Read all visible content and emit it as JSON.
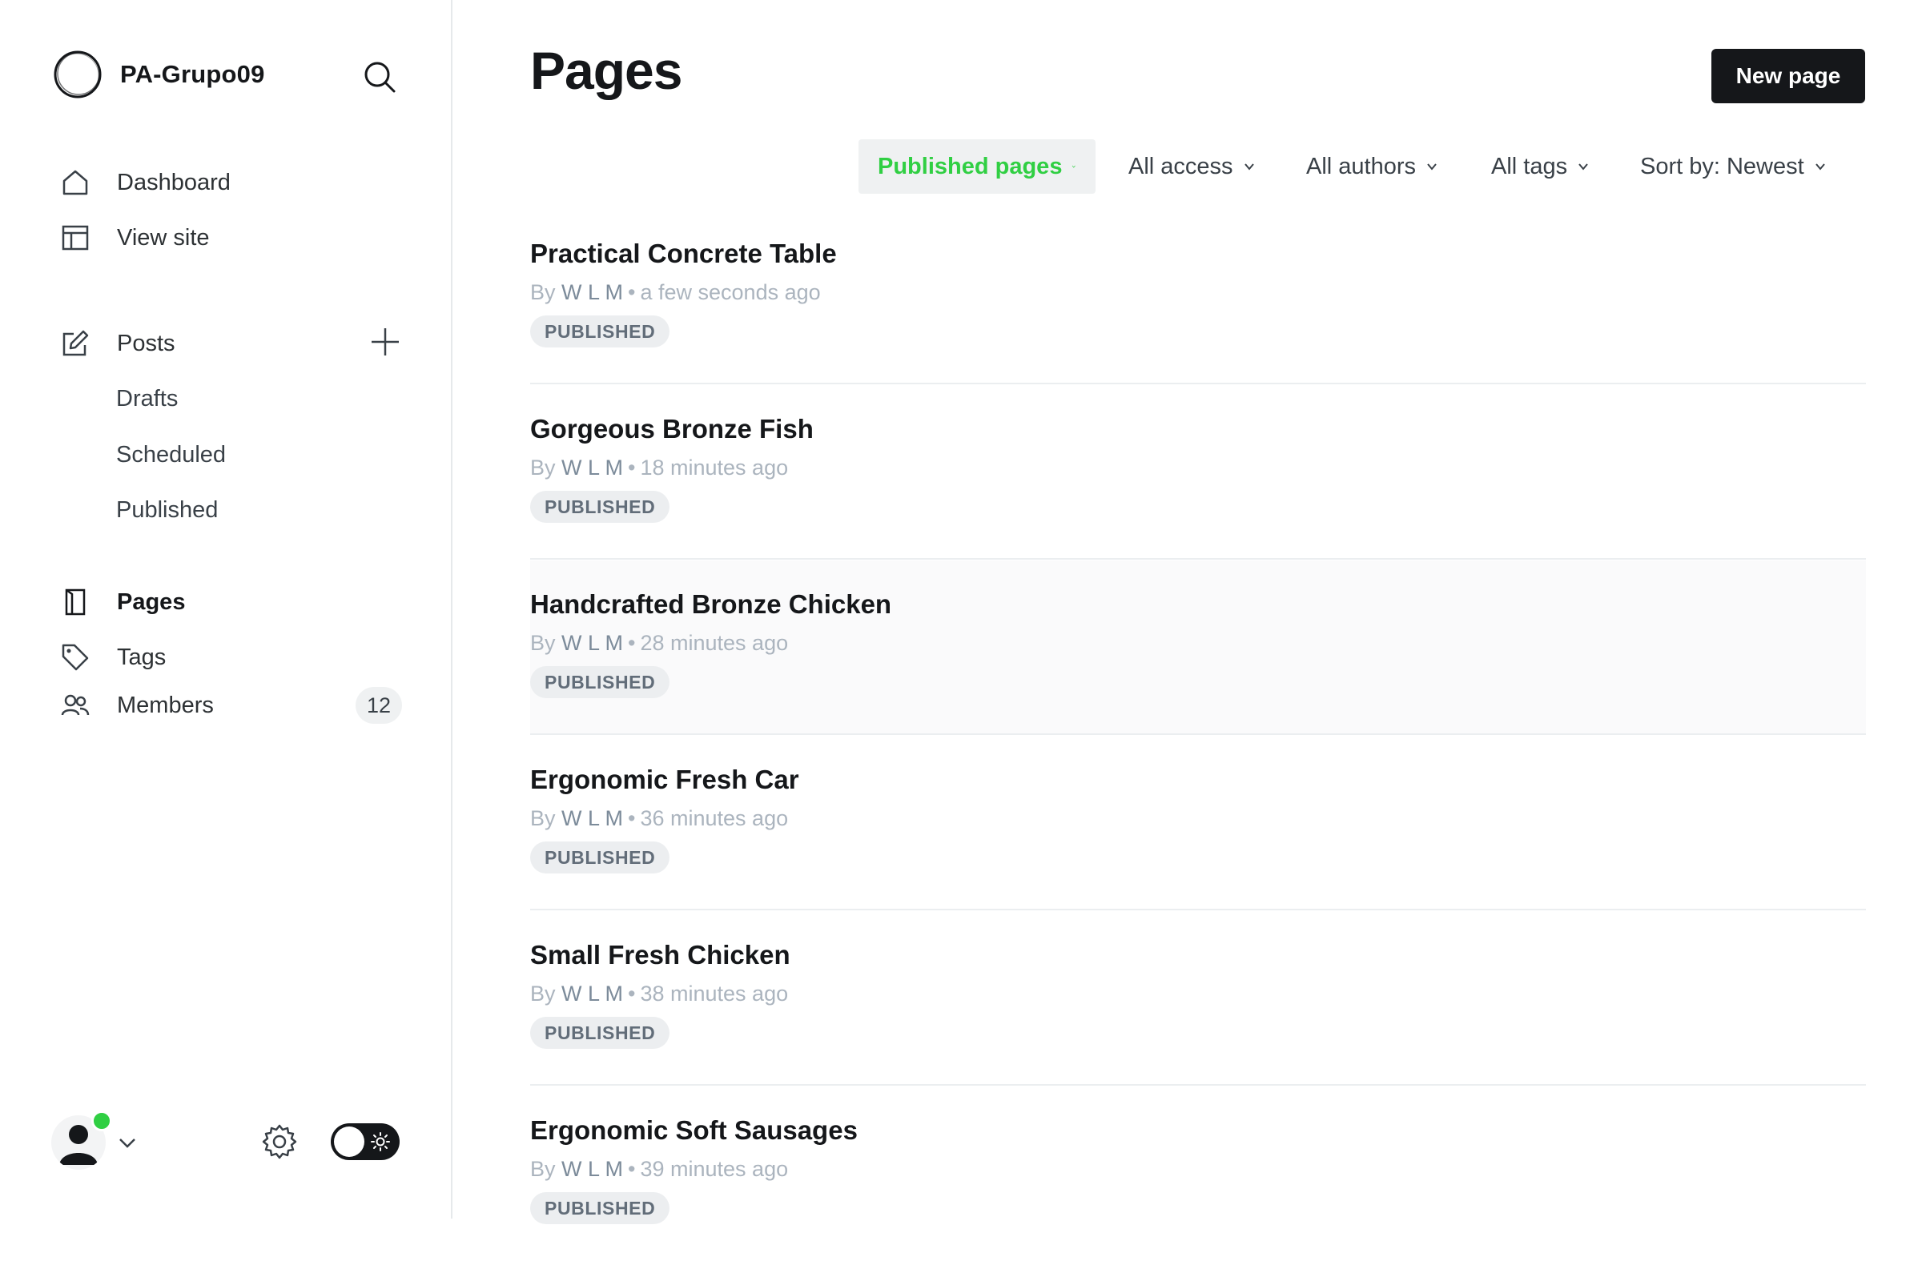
{
  "sidebar": {
    "site_name": "PA-Grupo09",
    "nav": {
      "dashboard": "Dashboard",
      "view_site": "View site",
      "posts": "Posts",
      "drafts": "Drafts",
      "scheduled": "Scheduled",
      "published": "Published",
      "pages": "Pages",
      "tags": "Tags",
      "members": "Members",
      "members_count": "12"
    }
  },
  "header": {
    "title": "Pages",
    "new_button": "New page"
  },
  "filters": {
    "type": "Published pages",
    "access": "All access",
    "authors": "All authors",
    "tags": "All tags",
    "sort": "Sort by: Newest"
  },
  "posts": [
    {
      "title": "Practical Concrete Table",
      "by": "By",
      "author": "W L M",
      "time": "a few seconds ago",
      "status": "PUBLISHED"
    },
    {
      "title": "Gorgeous Bronze Fish",
      "by": "By",
      "author": "W L M",
      "time": "18 minutes ago",
      "status": "PUBLISHED"
    },
    {
      "title": "Handcrafted Bronze Chicken",
      "by": "By",
      "author": "W L M",
      "time": "28 minutes ago",
      "status": "PUBLISHED"
    },
    {
      "title": "Ergonomic Fresh Car",
      "by": "By",
      "author": "W L M",
      "time": "36 minutes ago",
      "status": "PUBLISHED"
    },
    {
      "title": "Small Fresh Chicken",
      "by": "By",
      "author": "W L M",
      "time": "38 minutes ago",
      "status": "PUBLISHED"
    },
    {
      "title": "Ergonomic Soft Sausages",
      "by": "By",
      "author": "W L M",
      "time": "39 minutes ago",
      "status": "PUBLISHED"
    }
  ],
  "colors": {
    "accent": "#30cf43",
    "primary": "#15171a",
    "muted": "#abb4be"
  },
  "icons": [
    "brand-logo-icon",
    "search-icon",
    "home-icon",
    "view-site-icon",
    "edit-icon",
    "plus-icon",
    "pages-icon",
    "tag-icon",
    "members-icon",
    "user-icon",
    "chevron-down-icon",
    "gear-icon",
    "sun-icon"
  ]
}
